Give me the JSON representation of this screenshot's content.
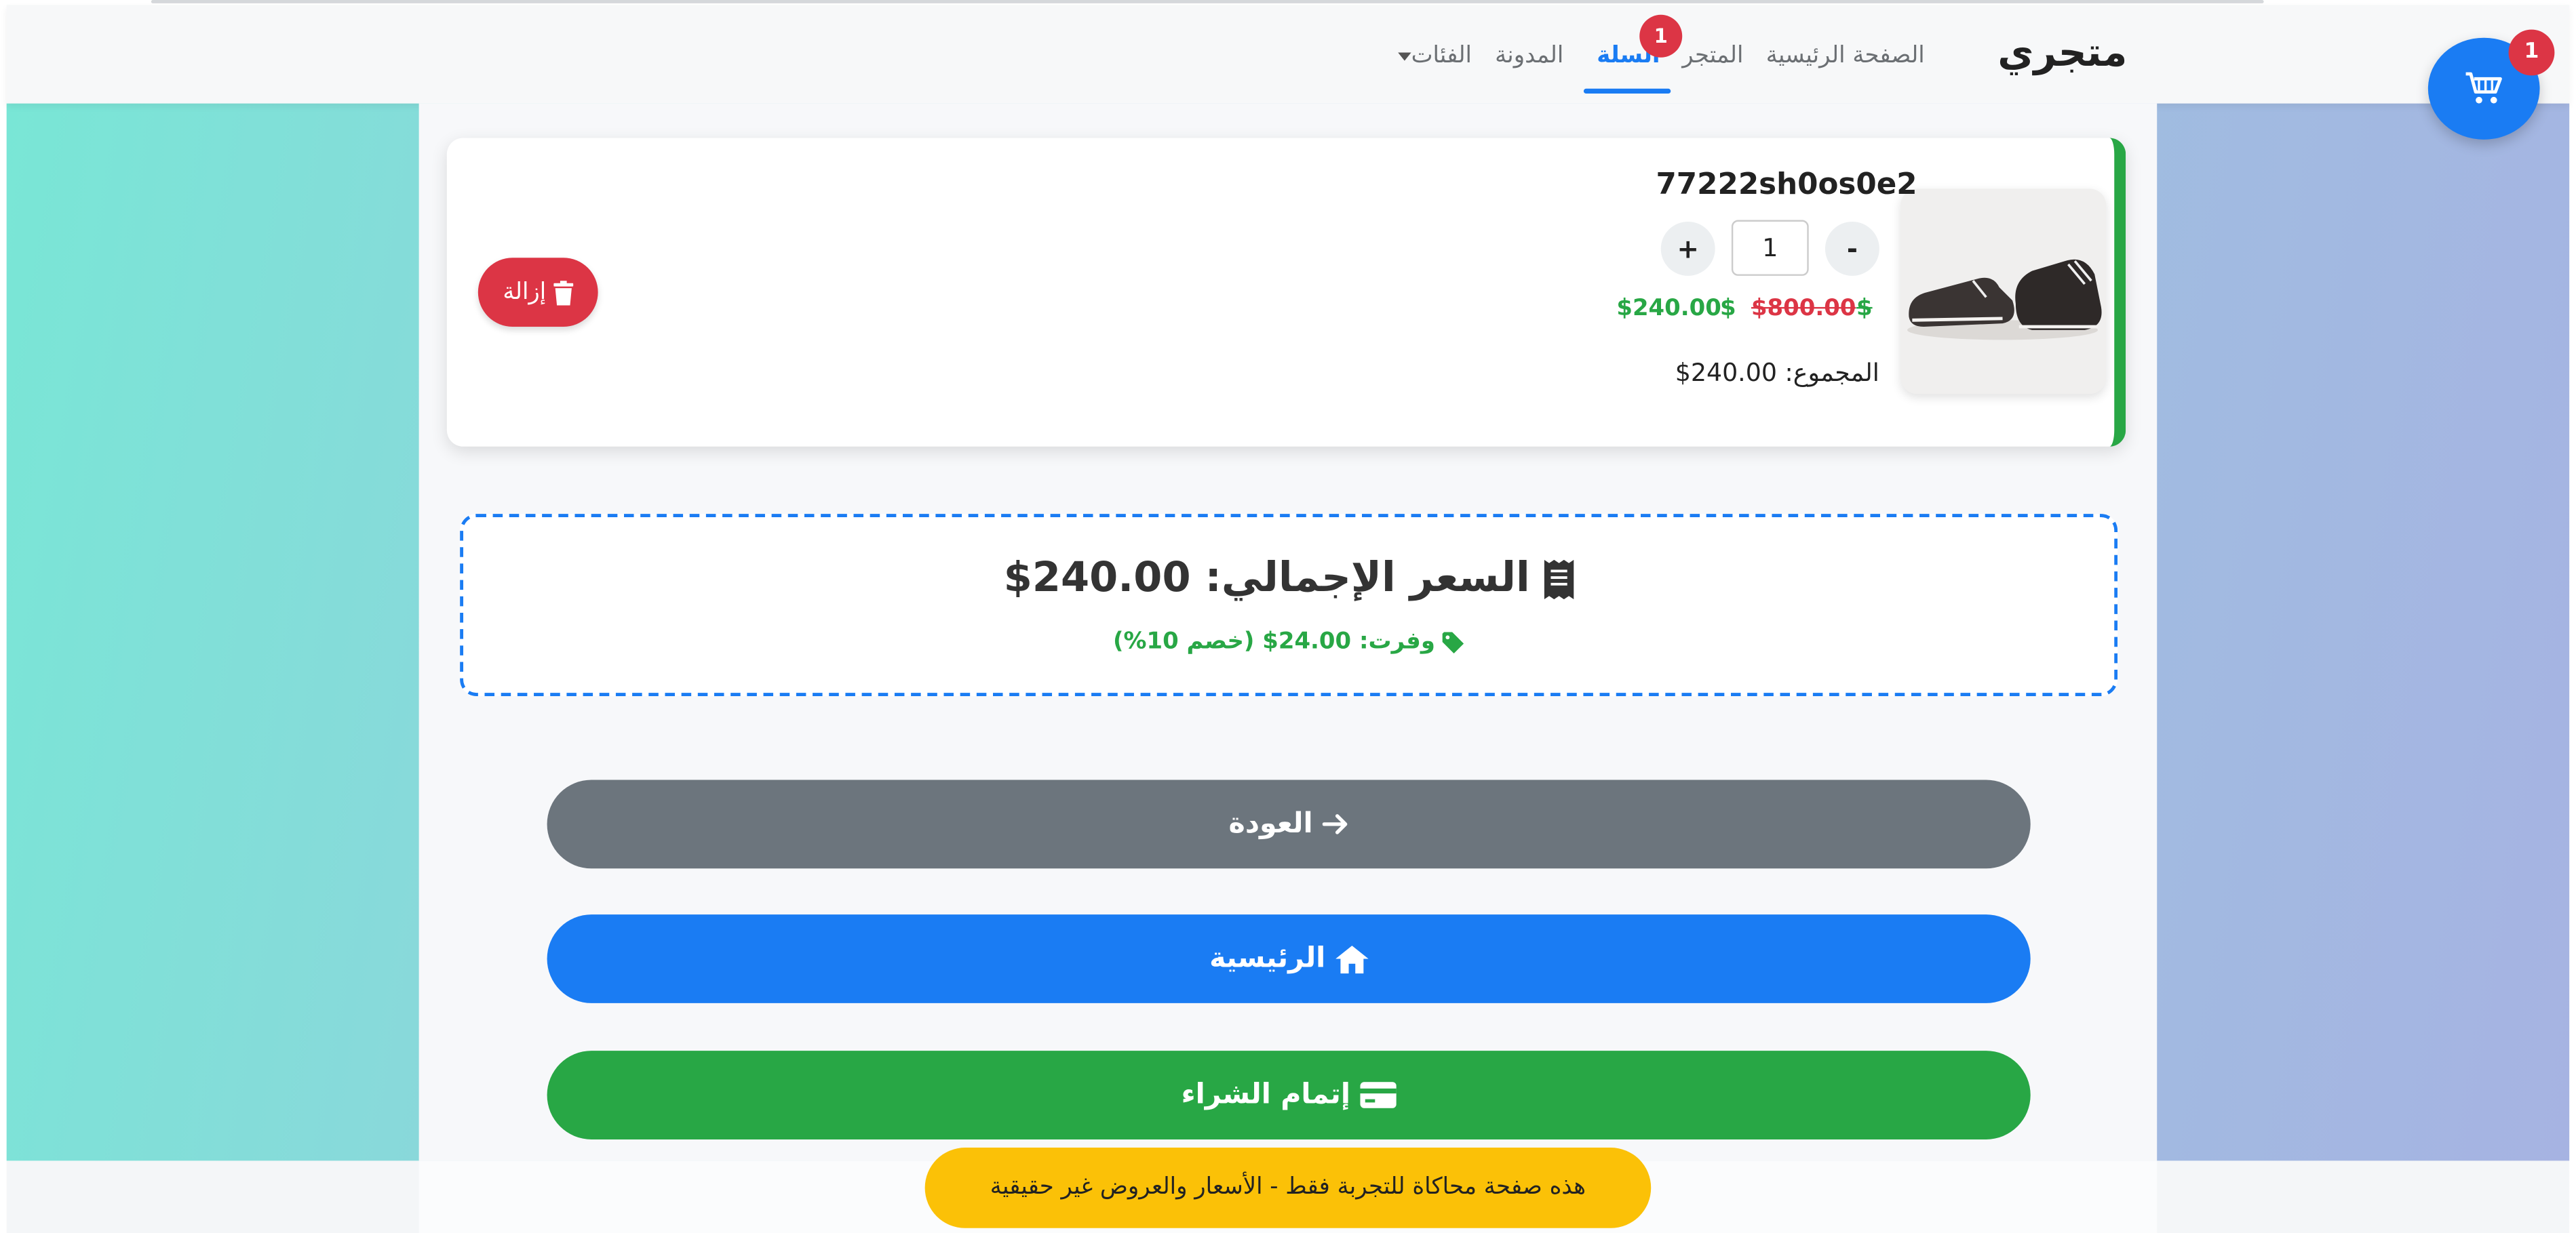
{
  "navbar": {
    "brand": "متجري",
    "links": {
      "home": "الصفحة الرئيسية",
      "store": "المتجر",
      "cart": "السلة",
      "blog": "المدونة",
      "categories": "الفئات"
    },
    "cart_badge": "1"
  },
  "floating_cart": {
    "badge": "1",
    "icon": "shopping-cart-icon"
  },
  "cart_item": {
    "name": "77222sh0os0e2",
    "quantity": "1",
    "qty_minus": "-",
    "qty_plus": "+",
    "old_price": "$800.00",
    "new_price": "$240.00",
    "currency_icon": "$",
    "line_total": "المجموع: 240.00$",
    "remove_label": "إزالة"
  },
  "summary": {
    "total": "السعر الإجمالي: 240.00$",
    "saved": "وفرت: 24.00$ (خصم 10%)"
  },
  "actions": {
    "back": "العودة",
    "home": "الرئيسية",
    "checkout": "إتمام الشراء"
  },
  "notice": "هذه صفحة محاكاة للتجربة فقط - الأسعار والعروض غير حقيقية",
  "colors": {
    "primary": "#1a7cf3",
    "success": "#28a745",
    "danger": "#dc3545",
    "secondary": "#6c757d",
    "warning": "#fbc107"
  }
}
